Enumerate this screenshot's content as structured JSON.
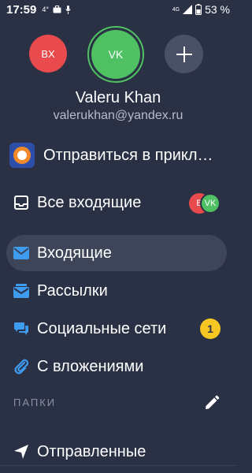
{
  "status_bar": {
    "time": "17:59",
    "temp": "4°",
    "network": "4G",
    "battery": "53 %"
  },
  "accounts": {
    "secondary_initials": "BX",
    "current_initials": "VK",
    "add_icon": "plus-icon"
  },
  "user": {
    "name": "Valeru Khan",
    "email": "valerukhan@yandex.ru"
  },
  "menu": {
    "promo_label": "Отправиться в приключение",
    "all_inbox_label": "Все входящие",
    "all_inbox_avatars": [
      "B",
      "VK"
    ],
    "inbox_label": "Входящие",
    "mailings_label": "Рассылки",
    "social_label": "Социальные сети",
    "social_badge": "1",
    "attachments_label": "С вложениями"
  },
  "folders": {
    "section_title": "ПАПКИ",
    "sent_label": "Отправленные"
  },
  "colors": {
    "background": "#2b3145",
    "accent_blue": "#3d9bf0",
    "badge_yellow": "#f6c623",
    "avatar_red": "#e84a4e",
    "avatar_green": "#4fc162"
  }
}
